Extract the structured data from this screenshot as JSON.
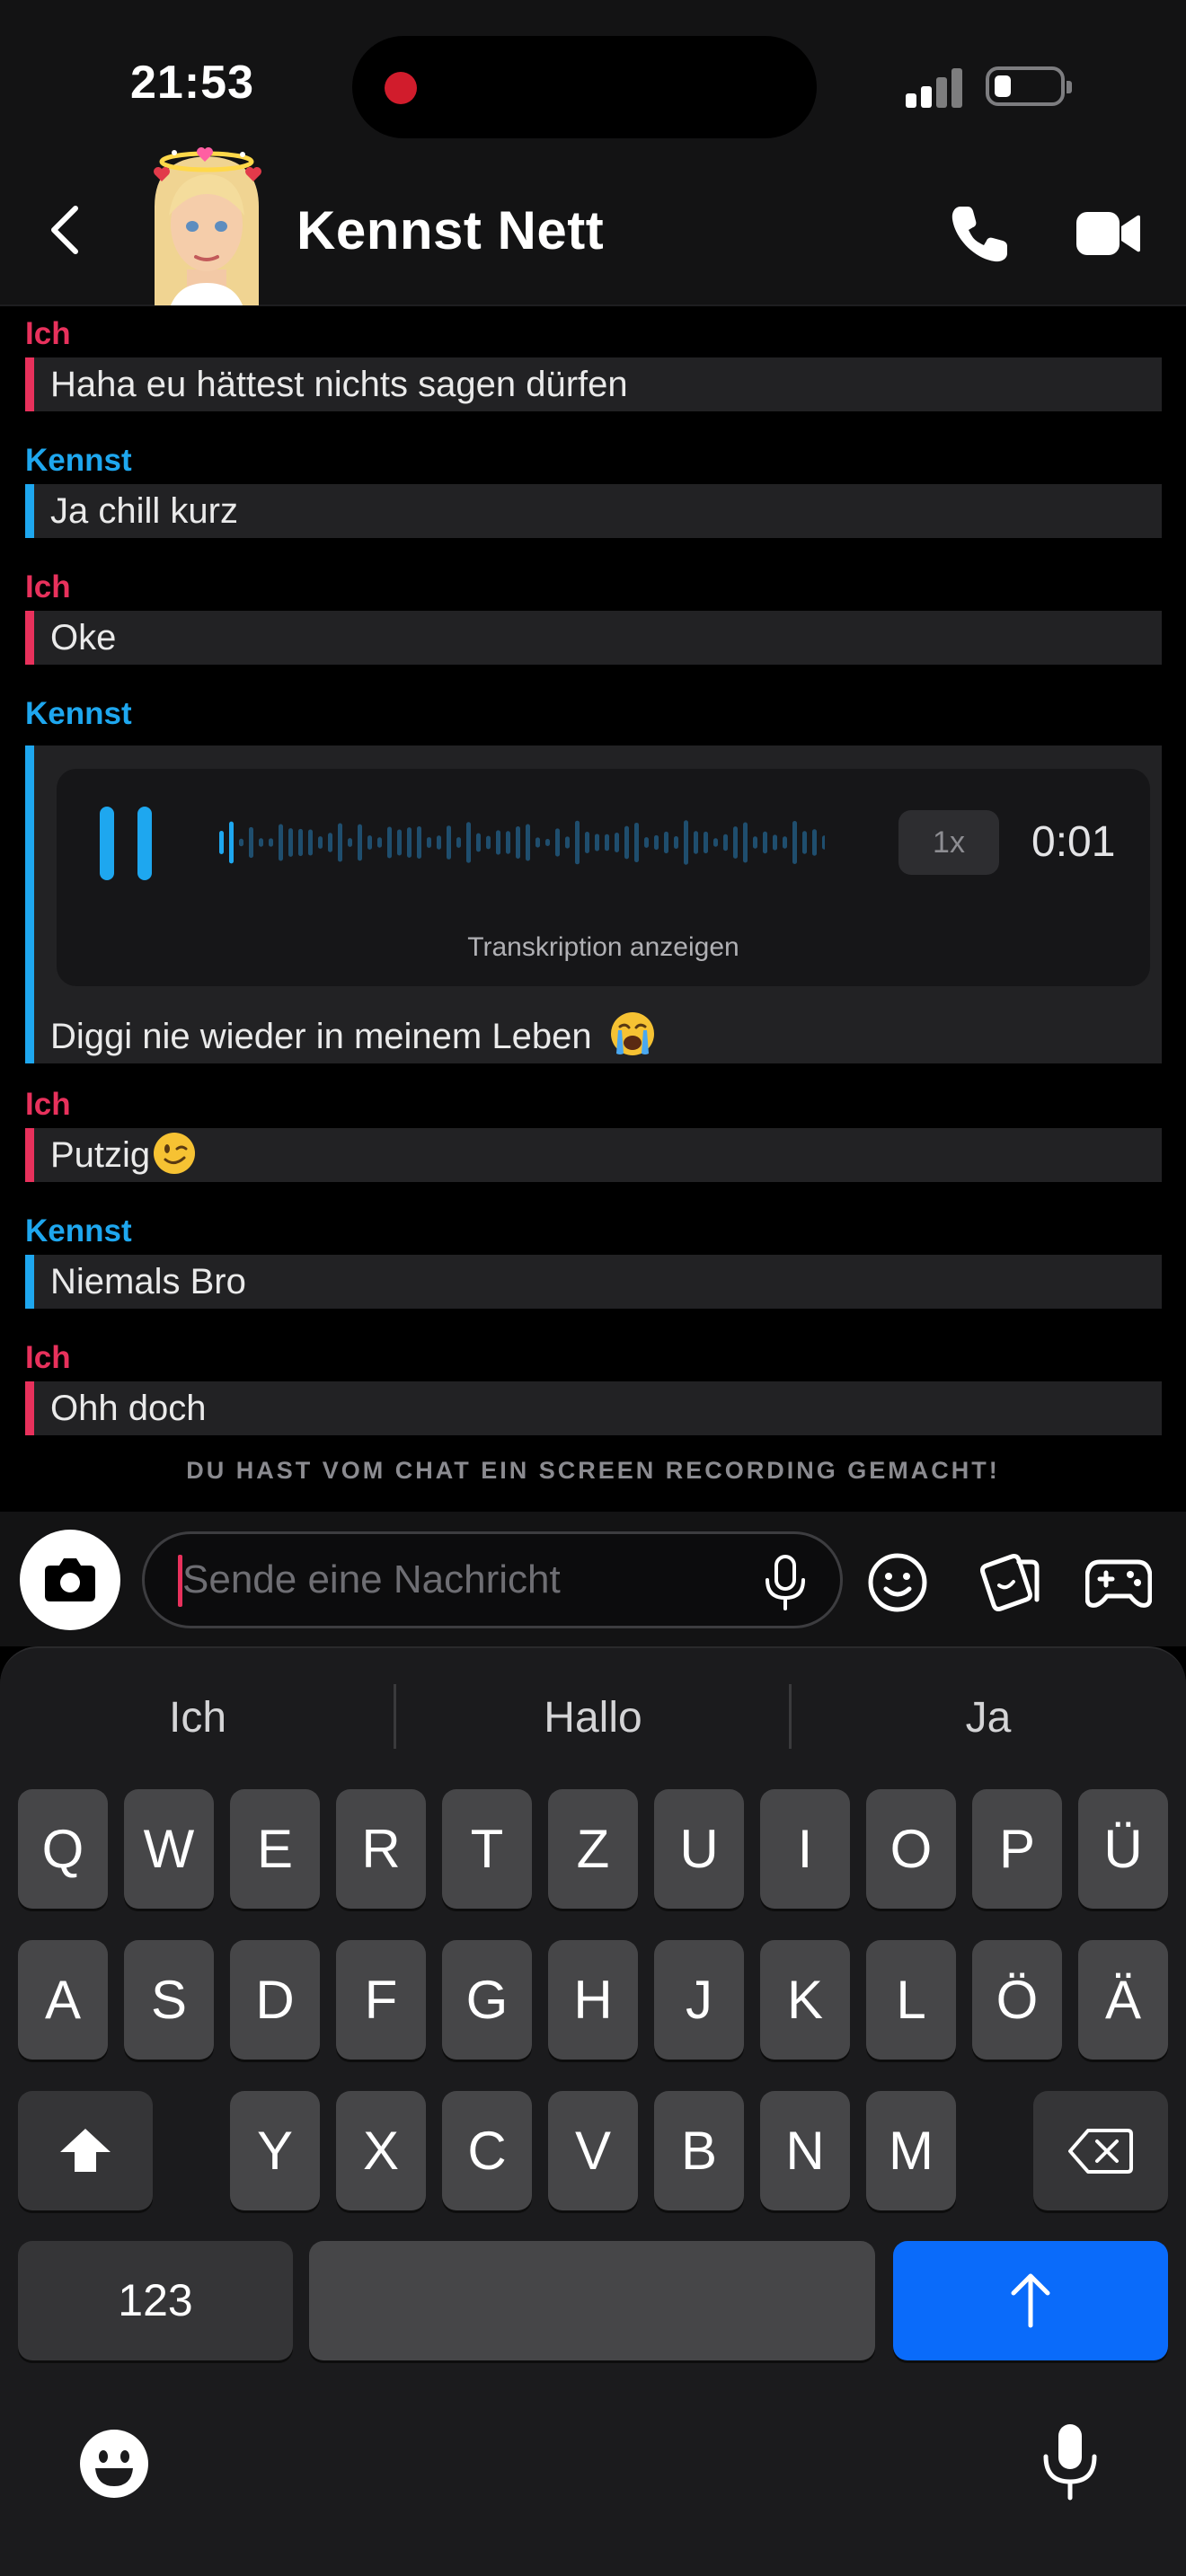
{
  "status_bar": {
    "time": "21:53"
  },
  "header": {
    "contact_name": "Kennst Nett",
    "back_icon": "chevron-left-icon",
    "call_icon": "phone-icon",
    "video_icon": "video-camera-icon"
  },
  "messages": [
    {
      "sender": "Ich",
      "side": "me",
      "text": "Haha eu hättest nichts sagen dürfen"
    },
    {
      "sender": "Kennst",
      "side": "them",
      "text": "Ja chill kurz"
    },
    {
      "sender": "Ich",
      "side": "me",
      "text": "Oke"
    },
    {
      "sender": "Kennst",
      "side": "them",
      "type": "voice",
      "speed": "1x",
      "duration": "0:01",
      "transcribe_label": "Transkription anzeigen",
      "caption": "Diggi nie wieder in meinem Leben",
      "caption_emoji": "loudly-crying-face"
    },
    {
      "sender": "Ich",
      "side": "me",
      "text": "Putzig",
      "emoji": "winking-face"
    },
    {
      "sender": "Kennst",
      "side": "them",
      "text": "Niemals Bro"
    },
    {
      "sender": "Ich",
      "side": "me",
      "text": "Ohh doch"
    }
  ],
  "notice": "DU HAST VOM CHAT EIN SCREEN RECORDING GEMACHT!",
  "composer": {
    "placeholder": "Sende eine Nachricht",
    "icons": [
      "camera-icon",
      "microphone-icon",
      "smiley-icon",
      "sticker-icon",
      "game-controller-icon"
    ]
  },
  "keyboard": {
    "suggestions": [
      "Ich",
      "Hallo",
      "Ja"
    ],
    "row1": [
      "Q",
      "W",
      "E",
      "R",
      "T",
      "Z",
      "U",
      "I",
      "O",
      "P",
      "Ü"
    ],
    "row2": [
      "A",
      "S",
      "D",
      "F",
      "G",
      "H",
      "J",
      "K",
      "L",
      "Ö",
      "Ä"
    ],
    "row3": [
      "Y",
      "X",
      "C",
      "V",
      "B",
      "N",
      "M"
    ],
    "numbers_label": "123",
    "return_color": "#0a6bfa"
  },
  "colors": {
    "me": "#e8315c",
    "them": "#1ea7ef"
  }
}
